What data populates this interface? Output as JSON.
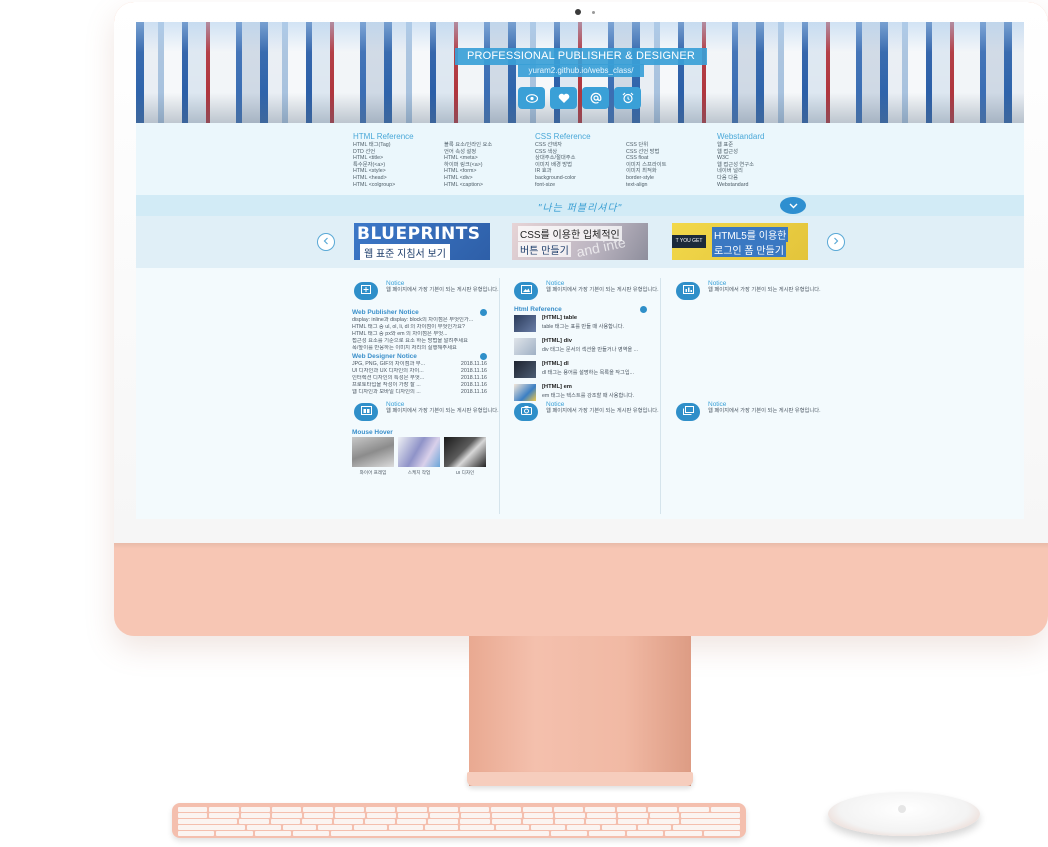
{
  "hero": {
    "title": "PROFESSIONAL PUBLISHER & DESIGNER",
    "url": "yuram2.github.io/webs_class/",
    "icons": [
      "eye-icon",
      "heart-icon",
      "at-icon",
      "alarm-clock-icon"
    ]
  },
  "reference": {
    "html": {
      "heading": "HTML Reference",
      "col1": [
        "HTML 태그(Tag)",
        "DTD 선언",
        "HTML <title>",
        "특수문자(<a>)",
        "HTML <style>",
        "HTML <head>",
        "HTML <colgroup>"
      ],
      "col2": [
        "블록 요소/인라인 요소",
        "언어 속성 설정",
        "HTML <meta>",
        "하이퍼 링크(<a>)",
        "HTML <form>",
        "HTML <div>",
        "HTML <caption>"
      ]
    },
    "css": {
      "heading": "CSS Reference",
      "col1": [
        "CSS 선택자",
        "CSS 색상",
        "상대주소/절대주소",
        "이미지 배경 방법",
        "IR 효과",
        "background-color",
        "font-size"
      ],
      "col2": [
        "CSS 단위",
        "CSS 선언 방법",
        "CSS float",
        "이미지 스프라이트",
        "이미지 최적화",
        "border-style",
        "text-align"
      ]
    },
    "web": {
      "heading": "Webstandard",
      "col1": [
        "웹 표준",
        "웹 접근성",
        "W3C",
        "웹 접근성 연구소",
        "네이버 널리",
        "다음 다음",
        "Webstandard"
      ]
    }
  },
  "slogan": "\"나는 퍼블리셔다\"",
  "slider": {
    "banner1": {
      "line1": "BLUEPRINTS",
      "line2": "웹 표준 지침서 보기"
    },
    "banner2": {
      "line1": "CSS를 이용한 입체적인",
      "line2": "버튼 만들기",
      "deco": "and inte"
    },
    "banner3": {
      "strip": "T YOU GET",
      "line1": "HTML5를 이용한",
      "line2": "로그인 폼 만들기"
    }
  },
  "notice_label": "Notice",
  "notice_text": "웹 페이지에서 가장 기본이 되는 게시판 유형입니다.",
  "web_publisher": {
    "title": "Web Publisher Notice",
    "items": [
      "display: inline과 display: block의 차이점은 무엇인가...",
      "HTML 태그 중 ul, ol, li, dl 의 차이점이 무엇인가요?",
      "HTML 태그 중 px와 em 의 차이점은 무엇...",
      "접근성 요소를 기준으로 요소 하는 방법을 알려주세요",
      "폭/높이를 반응하는 이미지 처리의 실행해주세요"
    ]
  },
  "web_designer": {
    "title": "Web Designer Notice",
    "items": [
      {
        "text": "JPG, PNG, GIF의 차이점과 무...",
        "date": "2018.11.16"
      },
      {
        "text": "UI 디자인과 UX 디자인의 차이...",
        "date": "2018.11.16"
      },
      {
        "text": "인터렉션 디자인의 특성은 무엇...",
        "date": "2018.11.16"
      },
      {
        "text": "프로토타입을 작성이 가장 잘 ...",
        "date": "2018.11.16"
      },
      {
        "text": "웹 디자인과 모바일 디자인의 ...",
        "date": "2018.11.16"
      }
    ]
  },
  "html_reference": {
    "title": "Html Reference",
    "items": [
      {
        "title": "[HTML] table",
        "desc": "table 태그는 표를 만들 때 사용합니다."
      },
      {
        "title": "[HTML] div",
        "desc": "div 태그는 문서의 섹션을 만들거나 영역을 ..."
      },
      {
        "title": "[HTML] dl",
        "desc": "dl 태그는 용어를 설명하는 목록을 작그입..."
      },
      {
        "title": "[HTML] em",
        "desc": "em 태그는 텍스트를 강조할 때 사용합니다."
      }
    ]
  },
  "mouse_hover": {
    "title": "Mouse Hover",
    "captions": [
      "와이어 프레임",
      "스케치 작업",
      "UI 디자인"
    ]
  },
  "colors": {
    "accent": "#3aa0d7",
    "device": "#f7c6b4",
    "section_bg": "#ebf7fc"
  }
}
